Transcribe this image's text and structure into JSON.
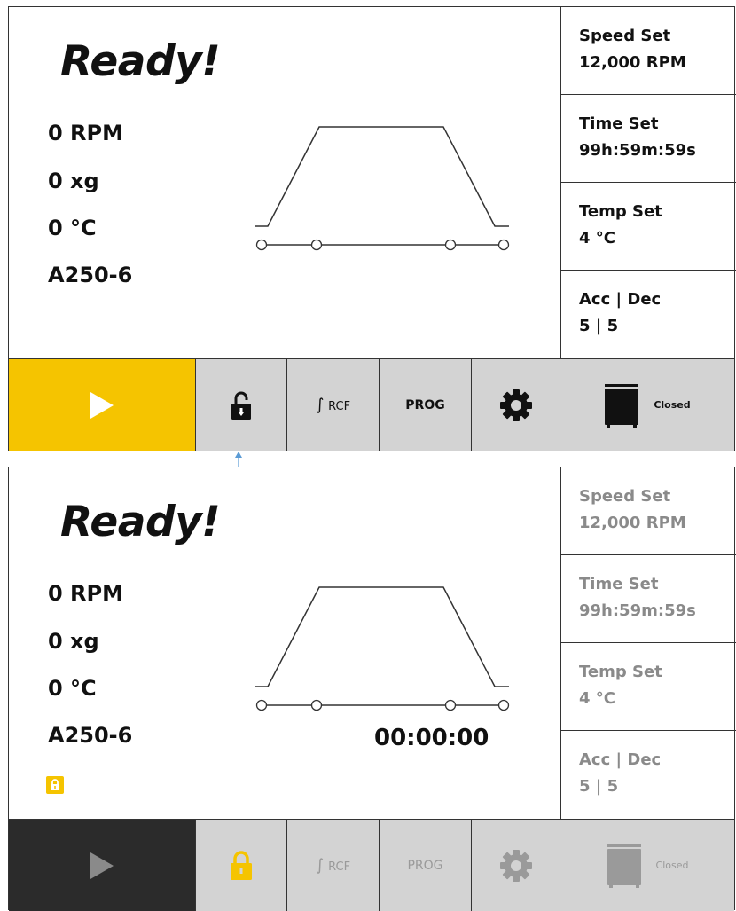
{
  "colors": {
    "accent_yellow": "#f5c400",
    "toolbar_gray": "#d3d3d3",
    "toolbar_gray_dim": "#a9a9a9",
    "start_dark": "#2b2b2b",
    "connector_blue": "#5b9bd5"
  },
  "top": {
    "status": "Ready!",
    "readings": {
      "speed": "0 RPM",
      "force": "0 xg",
      "temp": "0 °C",
      "rotor": "A250-6"
    },
    "side": [
      {
        "label": "Speed Set",
        "value": "12,000 RPM"
      },
      {
        "label": "Time Set",
        "value": "99h:59m:59s"
      },
      {
        "label": "Temp Set",
        "value": "4 °C"
      },
      {
        "label": "Acc | Dec",
        "value": "5 | 5"
      }
    ],
    "toolbar": {
      "start_icon": "play-icon",
      "lock_icon": "unlock-icon",
      "rcf_symbol": "∫",
      "rcf_label": "RCF",
      "prog_label": "PROG",
      "settings_icon": "gear-icon",
      "door_label": "Closed"
    }
  },
  "bottom": {
    "status": "Ready!",
    "readings": {
      "speed": "0 RPM",
      "force": "0 xg",
      "temp": "0 °C",
      "rotor": "A250-6"
    },
    "timer": "00:00:00",
    "side": [
      {
        "label": "Speed Set",
        "value": "12,000 RPM"
      },
      {
        "label": "Time Set",
        "value": "99h:59m:59s"
      },
      {
        "label": "Temp Set",
        "value": "4 °C"
      },
      {
        "label": "Acc | Dec",
        "value": "5 | 5"
      }
    ],
    "toolbar": {
      "start_icon": "play-icon",
      "lock_icon": "lock-icon",
      "rcf_symbol": "∫",
      "rcf_label": "RCF",
      "prog_label": "PROG",
      "settings_icon": "gear-icon",
      "door_label": "Closed"
    }
  }
}
